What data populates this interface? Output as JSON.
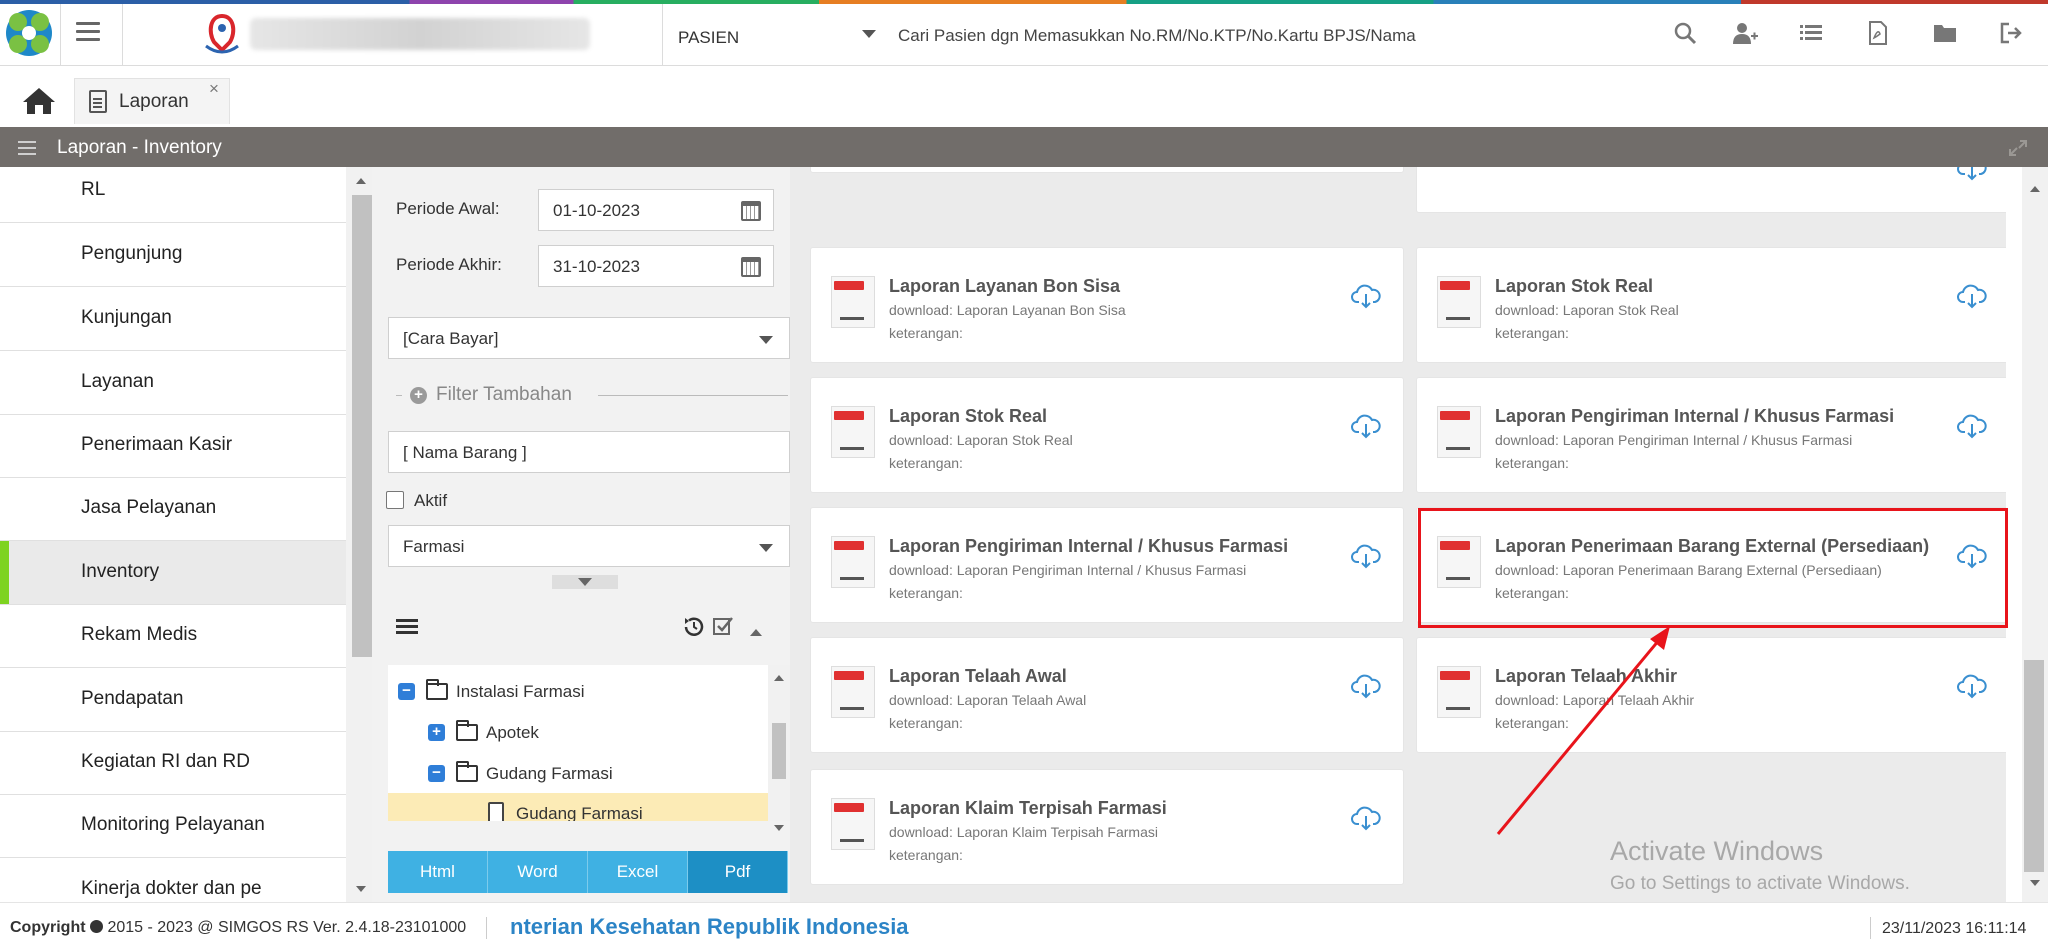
{
  "topbar": {
    "patient_select_label": "PASIEN",
    "search_placeholder": "Cari Pasien dgn Memasukkan No.RM/No.KTP/No.Kartu BPJS/Nama",
    "icons": [
      "search-icon",
      "add-user-icon",
      "list-icon",
      "pdf-file-icon",
      "folder-icon",
      "logout-icon"
    ]
  },
  "tabs": [
    {
      "label": "Laporan",
      "close": "×"
    }
  ],
  "panel": {
    "title": "Laporan - Inventory"
  },
  "categories": [
    {
      "label": "RL"
    },
    {
      "label": "Pengunjung"
    },
    {
      "label": "Kunjungan"
    },
    {
      "label": "Layanan"
    },
    {
      "label": "Penerimaan Kasir"
    },
    {
      "label": "Jasa Pelayanan"
    },
    {
      "label": "Inventory",
      "active": true
    },
    {
      "label": "Rekam Medis"
    },
    {
      "label": "Pendapatan"
    },
    {
      "label": "Kegiatan RI dan RD"
    },
    {
      "label": "Monitoring Pelayanan"
    },
    {
      "label": "Kinerja dokter dan pe"
    }
  ],
  "filter": {
    "periode_awal_label": "Periode Awal:",
    "periode_awal_value": "01-10-2023",
    "periode_akhir_label": "Periode Akhir:",
    "periode_akhir_value": "31-10-2023",
    "cara_bayar": "[Cara Bayar]",
    "filter_tambahan": "Filter Tambahan",
    "nama_barang": "[ Nama Barang ]",
    "aktif_label": "Aktif",
    "aktif_checked": false,
    "unit": "Farmasi",
    "tree": [
      {
        "label": "Instalasi Farmasi",
        "toggle": "−",
        "level": 0
      },
      {
        "label": "Apotek",
        "toggle": "+",
        "level": 1
      },
      {
        "label": "Gudang Farmasi",
        "toggle": "−",
        "level": 1
      },
      {
        "label": "Gudang Farmasi",
        "level": 2,
        "selected": true
      }
    ],
    "export": [
      {
        "label": "Html"
      },
      {
        "label": "Word"
      },
      {
        "label": "Excel"
      },
      {
        "label": "Pdf",
        "active": true
      }
    ]
  },
  "reports": [
    {
      "title": "Laporan Layanan Bon Sisa",
      "download": "download: Laporan Layanan Bon Sisa",
      "keterangan": "keterangan:"
    },
    {
      "title": "Laporan Stok Real",
      "download": "download: Laporan Stok Real",
      "keterangan": "keterangan:"
    },
    {
      "title": "Laporan Stok Real",
      "download": "download: Laporan Stok Real",
      "keterangan": "keterangan:"
    },
    {
      "title": "Laporan Pengiriman Internal / Khusus Farmasi",
      "download": "download: Laporan Pengiriman Internal / Khusus Farmasi",
      "keterangan": "keterangan:"
    },
    {
      "title": "Laporan Pengiriman Internal / Khusus Farmasi",
      "download": "download: Laporan Pengiriman Internal / Khusus Farmasi",
      "keterangan": "keterangan:"
    },
    {
      "title": "Laporan Penerimaan Barang External (Persediaan)",
      "download": "download: Laporan Penerimaan Barang External (Persediaan)",
      "keterangan": "keterangan:",
      "highlighted": true
    },
    {
      "title": "Laporan Telaah Awal",
      "download": "download: Laporan Telaah Awal",
      "keterangan": "keterangan:"
    },
    {
      "title": "Laporan Telaah Akhir",
      "download": "download: Laporan Telaah Akhir",
      "keterangan": "keterangan:"
    },
    {
      "title": "Laporan Klaim Terpisah Farmasi",
      "download": "download: Laporan Klaim Terpisah Farmasi",
      "keterangan": "keterangan:"
    }
  ],
  "annotation": {
    "highlight_color": "#e8141b",
    "arrow_color": "#e8141b"
  },
  "watermark": {
    "title": "Activate Windows",
    "subtitle": "Go to Settings to activate Windows."
  },
  "footer": {
    "copyright_prefix": "Copyright",
    "copyright_rest": "2015 - 2023 @ SIMGOS RS Ver. 2.4.18-23101000",
    "ministry": "nterian Kesehatan Republik Indonesia",
    "datetime": "23/11/2023 16:11:14"
  },
  "colors": {
    "panel_header": "#716d6a",
    "active_marker": "#7ed321",
    "export_button": "#3fb1e3",
    "export_active": "#1d8fc5",
    "ministry_text": "#2c84c6",
    "selected_tree": "#fcebb6"
  }
}
